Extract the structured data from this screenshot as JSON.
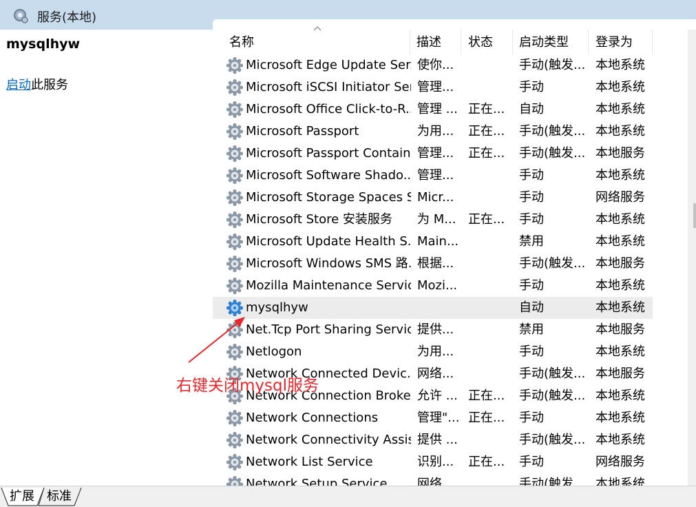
{
  "window": {
    "title": "服务(本地)"
  },
  "left_pane": {
    "service_name": "mysqlhyw",
    "start_link": "启动",
    "start_suffix": "此服务"
  },
  "columns": [
    "名称",
    "描述",
    "状态",
    "启动类型",
    "登录为"
  ],
  "rows": [
    {
      "name": "Microsoft Edge Update Ser...",
      "desc": "使你...",
      "status": "",
      "startup": "手动(触发...",
      "logon": "本地系统"
    },
    {
      "name": "Microsoft iSCSI Initiator Ser...",
      "desc": "管理...",
      "status": "",
      "startup": "手动",
      "logon": "本地系统"
    },
    {
      "name": "Microsoft Office Click-to-R...",
      "desc": "管理 ...",
      "status": "正在...",
      "startup": "自动",
      "logon": "本地系统"
    },
    {
      "name": "Microsoft Passport",
      "desc": "为用...",
      "status": "正在...",
      "startup": "手动(触发...",
      "logon": "本地系统"
    },
    {
      "name": "Microsoft Passport Container",
      "desc": "管理...",
      "status": "正在...",
      "startup": "手动(触发...",
      "logon": "本地服务"
    },
    {
      "name": "Microsoft Software Shado...",
      "desc": "管理...",
      "status": "",
      "startup": "手动",
      "logon": "本地系统"
    },
    {
      "name": "Microsoft Storage Spaces S...",
      "desc": "Micr...",
      "status": "",
      "startup": "手动",
      "logon": "网络服务"
    },
    {
      "name": "Microsoft Store 安装服务",
      "desc": "为 M...",
      "status": "正在...",
      "startup": "手动",
      "logon": "本地系统"
    },
    {
      "name": "Microsoft Update Health S...",
      "desc": "Main...",
      "status": "",
      "startup": "禁用",
      "logon": "本地系统"
    },
    {
      "name": "Microsoft Windows SMS 路...",
      "desc": "根据...",
      "status": "",
      "startup": "手动(触发...",
      "logon": "本地服务"
    },
    {
      "name": "Mozilla Maintenance Service",
      "desc": "Mozi...",
      "status": "",
      "startup": "手动",
      "logon": "本地系统"
    },
    {
      "name": "mysqlhyw",
      "desc": "",
      "status": "",
      "startup": "自动",
      "logon": "本地系统"
    },
    {
      "name": "Net.Tcp Port Sharing Service",
      "desc": "提供...",
      "status": "",
      "startup": "禁用",
      "logon": "本地服务"
    },
    {
      "name": "Netlogon",
      "desc": "为用...",
      "status": "",
      "startup": "手动",
      "logon": "本地系统"
    },
    {
      "name": "Network Connected Devic...",
      "desc": "网络...",
      "status": "",
      "startup": "手动(触发...",
      "logon": "本地服务"
    },
    {
      "name": "Network Connection Broker",
      "desc": "允许 ...",
      "status": "正在...",
      "startup": "手动(触发...",
      "logon": "本地系统"
    },
    {
      "name": "Network Connections",
      "desc": "管理\"...",
      "status": "正在...",
      "startup": "手动",
      "logon": "本地系统"
    },
    {
      "name": "Network Connectivity Assis...",
      "desc": "提供 ...",
      "status": "",
      "startup": "手动(触发...",
      "logon": "本地系统"
    },
    {
      "name": "Network List Service",
      "desc": "识别...",
      "status": "正在...",
      "startup": "手动",
      "logon": "网络服务"
    },
    {
      "name": "Network Setup Service",
      "desc": "网络...",
      "status": "",
      "startup": "手动(触发...",
      "logon": "本地系统"
    }
  ],
  "selected_row": "mysqlhyw",
  "tabs": [
    "扩展",
    "标准"
  ],
  "annotation": {
    "text": "右键关闭mysql服务",
    "color": "#e8262b"
  },
  "colors": {
    "title_bar": "#c9dcee",
    "link": "#0066cc",
    "selected_row": "#ececec"
  },
  "icons": {
    "title": "services-icon",
    "row": "gear-icon"
  }
}
